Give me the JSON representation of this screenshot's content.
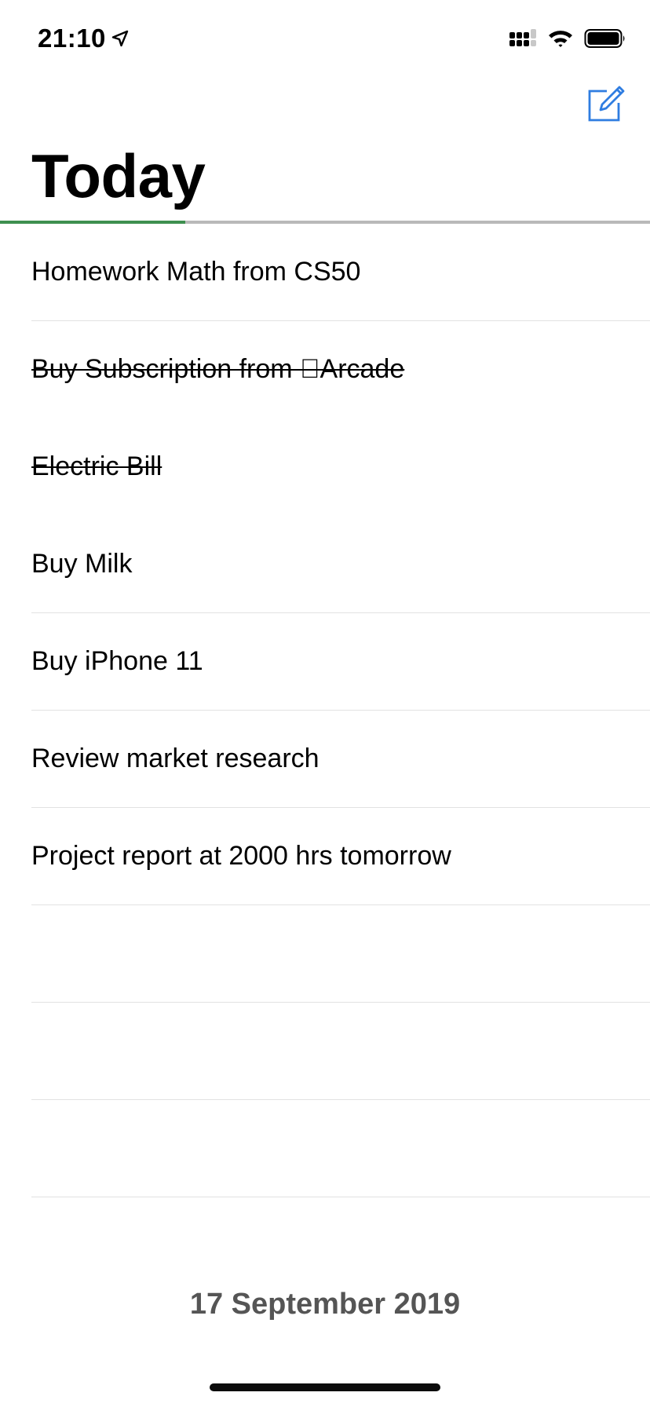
{
  "status_bar": {
    "time": "21:10",
    "icons": [
      "location-arrow-icon",
      "cellular-signal-icon",
      "wifi-icon",
      "battery-icon"
    ]
  },
  "header": {
    "compose_icon": "compose-icon",
    "title": "Today"
  },
  "progress": {
    "completed_fraction": 0.285,
    "fill_color": "#3e8f4f",
    "track_color": "#b9b9b9"
  },
  "tasks": [
    {
      "text": "Homework Math from CS50",
      "done": false
    },
    {
      "text": "Buy Subscription from Arcade",
      "done": true
    },
    {
      "text": "Electric Bill",
      "done": true
    },
    {
      "text": "Buy Milk",
      "done": false
    },
    {
      "text": "Buy iPhone 11",
      "done": false
    },
    {
      "text": "Review market research",
      "done": false
    },
    {
      "text": "Project report at 2000 hrs tomorrow",
      "done": false
    },
    {
      "text": "",
      "done": false
    },
    {
      "text": "",
      "done": false
    },
    {
      "text": "",
      "done": false
    }
  ],
  "footer": {
    "date": "17 September 2019"
  },
  "colors": {
    "accent": "#2f7de1",
    "done_progress": "#3e8f4f"
  }
}
